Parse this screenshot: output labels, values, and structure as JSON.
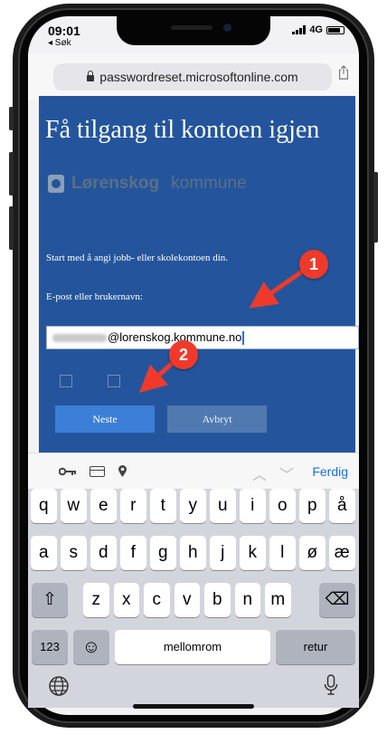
{
  "status_bar": {
    "time": "09:01",
    "back_app": "◂ Søk",
    "network": "4G"
  },
  "browser": {
    "url": "passwordreset.microsoftonline.com"
  },
  "page": {
    "title": "Få tilgang til kontoen igjen",
    "logo_strong": "Lørenskog",
    "logo_light": "kommune",
    "intro": "Start med å angi jobb- eller skolekontoen din.",
    "email_label": "E-post eller brukernavn:",
    "email_value": "@lorenskog.kommune.no",
    "next_button": "Neste",
    "cancel_button": "Avbryt"
  },
  "annotations": {
    "callout_1": "1",
    "callout_2": "2",
    "color": "#ef3a2b"
  },
  "keyboard_toolbar": {
    "done": "Ferdig",
    "prev": "︿",
    "next": "﹀"
  },
  "keyboard": {
    "row1": [
      "q",
      "w",
      "e",
      "r",
      "t",
      "y",
      "u",
      "i",
      "o",
      "p",
      "å"
    ],
    "row2": [
      "a",
      "s",
      "d",
      "f",
      "g",
      "h",
      "j",
      "k",
      "l",
      "ø",
      "æ"
    ],
    "row3": [
      "z",
      "x",
      "c",
      "v",
      "b",
      "n",
      "m"
    ],
    "numbers_key": "123",
    "emoji_key": "☺",
    "space_key": "mellomrom",
    "return_key": "retur",
    "shift_key": "⇧",
    "delete_key": "⌫"
  },
  "colors": {
    "page_background": "#24559c",
    "primary_button": "#3b7fd8",
    "accent": "#1a6fe0"
  }
}
